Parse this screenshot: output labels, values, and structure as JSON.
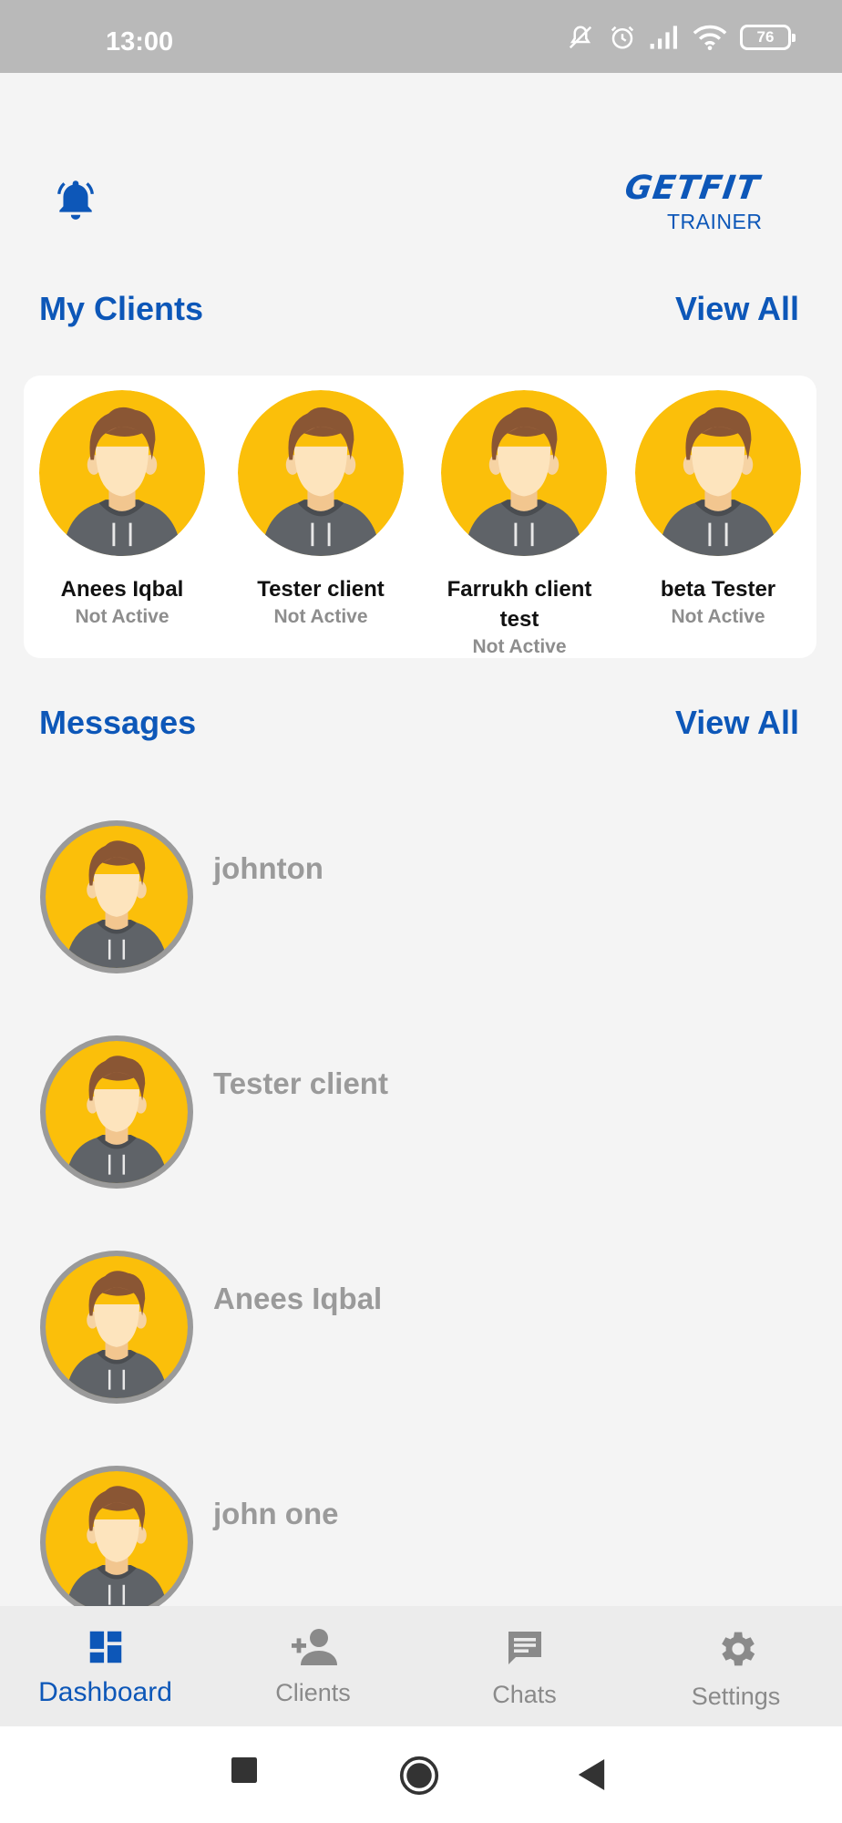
{
  "status_bar": {
    "time": "13:00",
    "battery": "76"
  },
  "header": {
    "brand_name": "GETFIT",
    "brand_sub": "TRAINER"
  },
  "my_clients": {
    "title": "My Clients",
    "view_all": "View All",
    "clients": [
      {
        "name": "Anees Iqbal",
        "status": "Not Active"
      },
      {
        "name": "Tester client",
        "status": "Not Active"
      },
      {
        "name": "Farrukh client test",
        "status": "Not Active"
      },
      {
        "name": "beta Tester",
        "status": "Not Active"
      }
    ]
  },
  "messages": {
    "title": "Messages",
    "view_all": "View All",
    "items": [
      {
        "name": "johnton"
      },
      {
        "name": "Tester client"
      },
      {
        "name": "Anees Iqbal"
      },
      {
        "name": "john one"
      }
    ]
  },
  "bottom_nav": {
    "items": [
      {
        "label": "Dashboard",
        "icon": "dashboard-icon",
        "active": true
      },
      {
        "label": "Clients",
        "icon": "add-person-icon",
        "active": false
      },
      {
        "label": "Chats",
        "icon": "chat-icon",
        "active": false
      },
      {
        "label": "Settings",
        "icon": "gear-icon",
        "active": false
      }
    ]
  },
  "colors": {
    "accent": "#0d57b8",
    "avatar_bg": "#fbbf0a",
    "muted": "#9a9a9a"
  }
}
